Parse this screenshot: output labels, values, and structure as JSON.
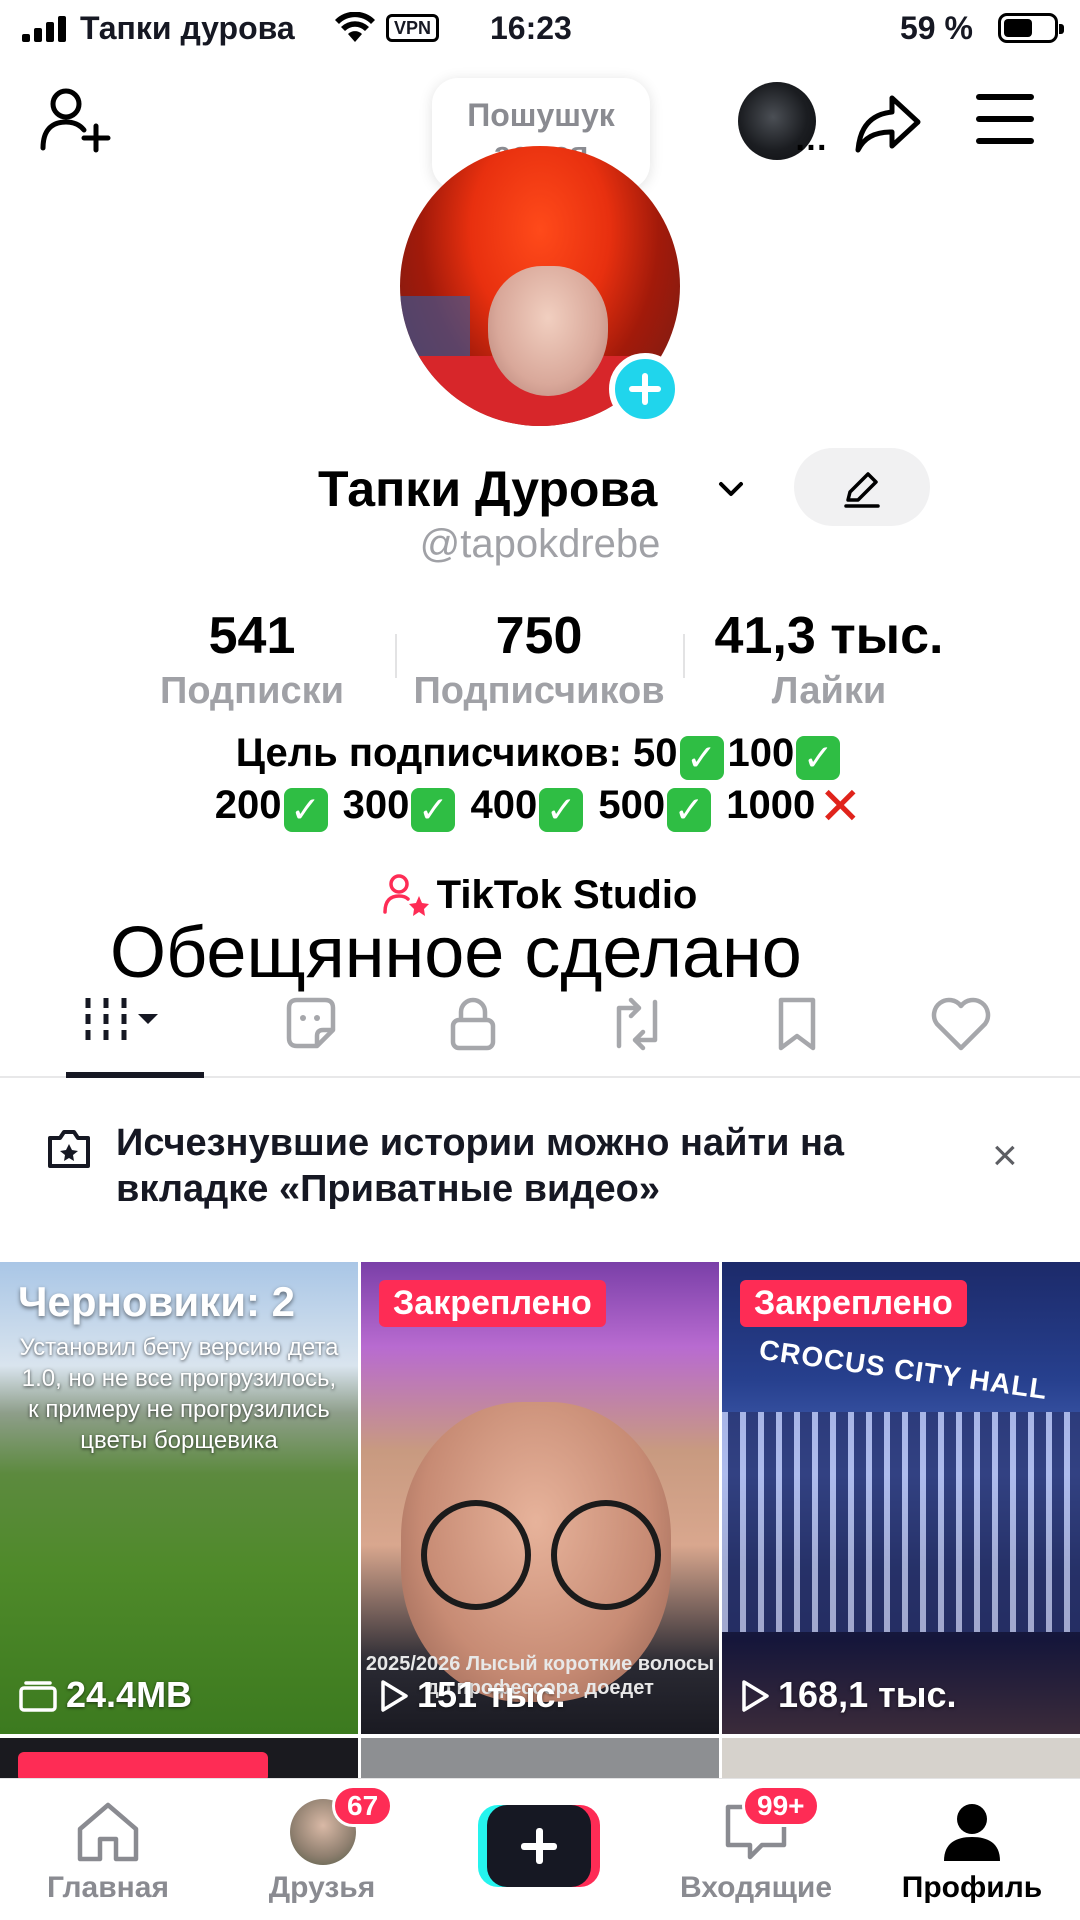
{
  "status_bar": {
    "carrier": "Тапки дурова",
    "vpn": "VPN",
    "time": "16:23",
    "battery_percent_text": "59 %",
    "battery_level": 0.59
  },
  "bubble": {
    "text": "Пошушук аемся"
  },
  "profile": {
    "name": "Тапки Дурова",
    "username": "@tapokdrebe"
  },
  "stats": [
    {
      "value": "541",
      "label": "Подписки"
    },
    {
      "value": "750",
      "label": "Подписчиков"
    },
    {
      "value": "41,3 тыс.",
      "label": "Лайки"
    }
  ],
  "bio": {
    "line1_prefix": "Цель подписчиков: 50",
    "goals_line1_b": "100",
    "goals": [
      "200",
      "300",
      "400",
      "500"
    ],
    "goal_last": "1000",
    "check_glyph": "✓",
    "cross_glyph": "✕"
  },
  "studio": {
    "label": "TikTok Studio"
  },
  "overlay_text": "Обещянное сделано",
  "tabs": [
    {
      "icon": "grid-icon",
      "active": true
    },
    {
      "icon": "sticker-icon"
    },
    {
      "icon": "lock-icon"
    },
    {
      "icon": "repost-icon"
    },
    {
      "icon": "bookmark-icon"
    },
    {
      "icon": "heart-icon"
    }
  ],
  "banner": {
    "text": "Исчезнувшие истории можно найти на вкладке «Приватные видео»",
    "close": "×"
  },
  "grid": [
    {
      "title": "Черновики: 2",
      "description": "Установил бету версию дета 1.0, но не все прогрузилось, к примеру не прогрузились цветы борщевика",
      "meta": "24.4MB"
    },
    {
      "badge": "Закреплено",
      "caption": "2025/2026 Лысый короткие волосы до профессора доедет",
      "meta": "151 тыс."
    },
    {
      "badge": "Закреплено",
      "sign": "CROCUS CITY HALL",
      "meta": "168,1 тыс."
    }
  ],
  "bottom_nav": {
    "items": [
      {
        "label": "Главная",
        "icon": "home-icon"
      },
      {
        "label": "Друзья",
        "icon": "friends-avatar",
        "badge": "67"
      },
      {
        "label": "",
        "icon": "create-icon"
      },
      {
        "label": "Входящие",
        "icon": "inbox-icon",
        "badge": "99+"
      },
      {
        "label": "Профиль",
        "icon": "profile-icon",
        "active": true
      }
    ]
  },
  "colors": {
    "accent": "#fe2c55",
    "cyan": "#25f4ee",
    "avatar_plus": "#20d5ec",
    "text": "#161823",
    "secondary_text": "#a0a1a6"
  }
}
